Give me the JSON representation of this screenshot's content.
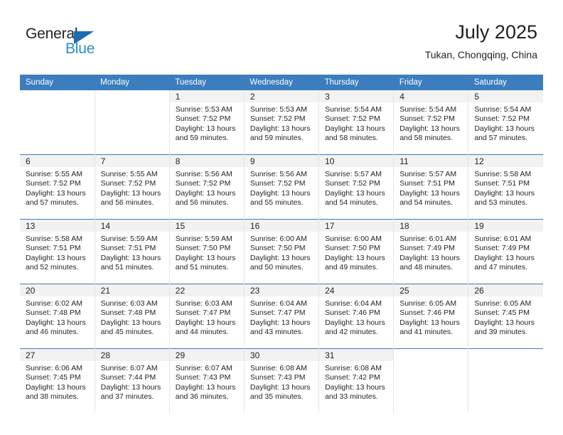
{
  "logo": {
    "word_top": "General",
    "word_bottom": "Blue",
    "triangle_color": "#1b6cb0",
    "blue_color": "#2a8ad4"
  },
  "header": {
    "title": "July 2025",
    "subtitle": "Tukan, Chongqing, China",
    "header_bg": "#3b7dbd",
    "daynum_bg": "#f2f2f2"
  },
  "weekday_headers": [
    "Sunday",
    "Monday",
    "Tuesday",
    "Wednesday",
    "Thursday",
    "Friday",
    "Saturday"
  ],
  "weeks": [
    [
      {
        "day": "",
        "lines": []
      },
      {
        "day": "",
        "lines": []
      },
      {
        "day": "1",
        "lines": [
          "Sunrise: 5:53 AM",
          "Sunset: 7:52 PM",
          "Daylight: 13 hours",
          "and 59 minutes."
        ]
      },
      {
        "day": "2",
        "lines": [
          "Sunrise: 5:53 AM",
          "Sunset: 7:52 PM",
          "Daylight: 13 hours",
          "and 59 minutes."
        ]
      },
      {
        "day": "3",
        "lines": [
          "Sunrise: 5:54 AM",
          "Sunset: 7:52 PM",
          "Daylight: 13 hours",
          "and 58 minutes."
        ]
      },
      {
        "day": "4",
        "lines": [
          "Sunrise: 5:54 AM",
          "Sunset: 7:52 PM",
          "Daylight: 13 hours",
          "and 58 minutes."
        ]
      },
      {
        "day": "5",
        "lines": [
          "Sunrise: 5:54 AM",
          "Sunset: 7:52 PM",
          "Daylight: 13 hours",
          "and 57 minutes."
        ]
      }
    ],
    [
      {
        "day": "6",
        "lines": [
          "Sunrise: 5:55 AM",
          "Sunset: 7:52 PM",
          "Daylight: 13 hours",
          "and 57 minutes."
        ]
      },
      {
        "day": "7",
        "lines": [
          "Sunrise: 5:55 AM",
          "Sunset: 7:52 PM",
          "Daylight: 13 hours",
          "and 56 minutes."
        ]
      },
      {
        "day": "8",
        "lines": [
          "Sunrise: 5:56 AM",
          "Sunset: 7:52 PM",
          "Daylight: 13 hours",
          "and 56 minutes."
        ]
      },
      {
        "day": "9",
        "lines": [
          "Sunrise: 5:56 AM",
          "Sunset: 7:52 PM",
          "Daylight: 13 hours",
          "and 55 minutes."
        ]
      },
      {
        "day": "10",
        "lines": [
          "Sunrise: 5:57 AM",
          "Sunset: 7:52 PM",
          "Daylight: 13 hours",
          "and 54 minutes."
        ]
      },
      {
        "day": "11",
        "lines": [
          "Sunrise: 5:57 AM",
          "Sunset: 7:51 PM",
          "Daylight: 13 hours",
          "and 54 minutes."
        ]
      },
      {
        "day": "12",
        "lines": [
          "Sunrise: 5:58 AM",
          "Sunset: 7:51 PM",
          "Daylight: 13 hours",
          "and 53 minutes."
        ]
      }
    ],
    [
      {
        "day": "13",
        "lines": [
          "Sunrise: 5:58 AM",
          "Sunset: 7:51 PM",
          "Daylight: 13 hours",
          "and 52 minutes."
        ]
      },
      {
        "day": "14",
        "lines": [
          "Sunrise: 5:59 AM",
          "Sunset: 7:51 PM",
          "Daylight: 13 hours",
          "and 51 minutes."
        ]
      },
      {
        "day": "15",
        "lines": [
          "Sunrise: 5:59 AM",
          "Sunset: 7:50 PM",
          "Daylight: 13 hours",
          "and 51 minutes."
        ]
      },
      {
        "day": "16",
        "lines": [
          "Sunrise: 6:00 AM",
          "Sunset: 7:50 PM",
          "Daylight: 13 hours",
          "and 50 minutes."
        ]
      },
      {
        "day": "17",
        "lines": [
          "Sunrise: 6:00 AM",
          "Sunset: 7:50 PM",
          "Daylight: 13 hours",
          "and 49 minutes."
        ]
      },
      {
        "day": "18",
        "lines": [
          "Sunrise: 6:01 AM",
          "Sunset: 7:49 PM",
          "Daylight: 13 hours",
          "and 48 minutes."
        ]
      },
      {
        "day": "19",
        "lines": [
          "Sunrise: 6:01 AM",
          "Sunset: 7:49 PM",
          "Daylight: 13 hours",
          "and 47 minutes."
        ]
      }
    ],
    [
      {
        "day": "20",
        "lines": [
          "Sunrise: 6:02 AM",
          "Sunset: 7:48 PM",
          "Daylight: 13 hours",
          "and 46 minutes."
        ]
      },
      {
        "day": "21",
        "lines": [
          "Sunrise: 6:03 AM",
          "Sunset: 7:48 PM",
          "Daylight: 13 hours",
          "and 45 minutes."
        ]
      },
      {
        "day": "22",
        "lines": [
          "Sunrise: 6:03 AM",
          "Sunset: 7:47 PM",
          "Daylight: 13 hours",
          "and 44 minutes."
        ]
      },
      {
        "day": "23",
        "lines": [
          "Sunrise: 6:04 AM",
          "Sunset: 7:47 PM",
          "Daylight: 13 hours",
          "and 43 minutes."
        ]
      },
      {
        "day": "24",
        "lines": [
          "Sunrise: 6:04 AM",
          "Sunset: 7:46 PM",
          "Daylight: 13 hours",
          "and 42 minutes."
        ]
      },
      {
        "day": "25",
        "lines": [
          "Sunrise: 6:05 AM",
          "Sunset: 7:46 PM",
          "Daylight: 13 hours",
          "and 41 minutes."
        ]
      },
      {
        "day": "26",
        "lines": [
          "Sunrise: 6:05 AM",
          "Sunset: 7:45 PM",
          "Daylight: 13 hours",
          "and 39 minutes."
        ]
      }
    ],
    [
      {
        "day": "27",
        "lines": [
          "Sunrise: 6:06 AM",
          "Sunset: 7:45 PM",
          "Daylight: 13 hours",
          "and 38 minutes."
        ]
      },
      {
        "day": "28",
        "lines": [
          "Sunrise: 6:07 AM",
          "Sunset: 7:44 PM",
          "Daylight: 13 hours",
          "and 37 minutes."
        ]
      },
      {
        "day": "29",
        "lines": [
          "Sunrise: 6:07 AM",
          "Sunset: 7:43 PM",
          "Daylight: 13 hours",
          "and 36 minutes."
        ]
      },
      {
        "day": "30",
        "lines": [
          "Sunrise: 6:08 AM",
          "Sunset: 7:43 PM",
          "Daylight: 13 hours",
          "and 35 minutes."
        ]
      },
      {
        "day": "31",
        "lines": [
          "Sunrise: 6:08 AM",
          "Sunset: 7:42 PM",
          "Daylight: 13 hours",
          "and 33 minutes."
        ]
      },
      {
        "day": "",
        "lines": []
      },
      {
        "day": "",
        "lines": []
      }
    ]
  ]
}
